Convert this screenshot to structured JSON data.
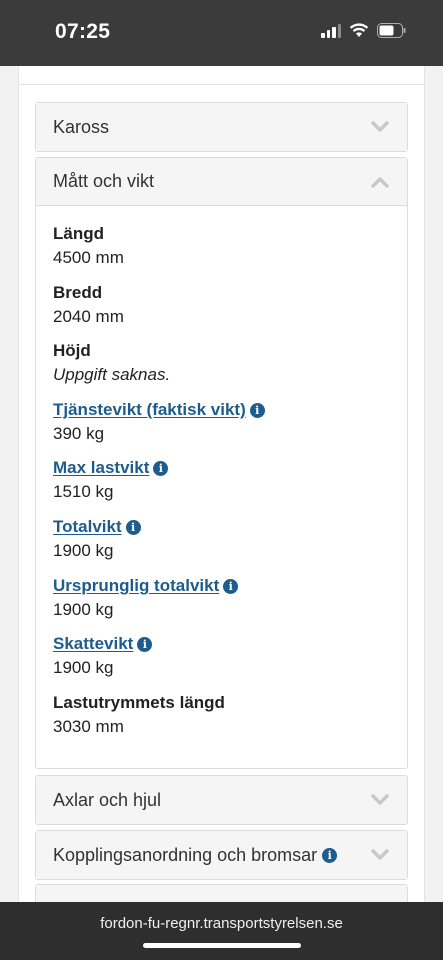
{
  "status_bar": {
    "time": "07:25"
  },
  "panels": {
    "kaross": {
      "title": "Kaross"
    },
    "matt": {
      "title": "Mått och vikt",
      "fields": [
        {
          "label": "Längd",
          "value": "4500 mm"
        },
        {
          "label": "Bredd",
          "value": "2040 mm"
        },
        {
          "label": "Höjd",
          "value": "Uppgift saknas."
        },
        {
          "label": "Tjänstevikt (faktisk vikt)",
          "value": "390 kg"
        },
        {
          "label": "Max lastvikt",
          "value": "1510 kg"
        },
        {
          "label": "Totalvikt",
          "value": "1900 kg"
        },
        {
          "label": "Ursprunglig totalvikt",
          "value": "1900 kg"
        },
        {
          "label": "Skattevikt",
          "value": "1900 kg"
        },
        {
          "label": "Lastutrymmets längd",
          "value": "3030 mm"
        }
      ]
    },
    "axlar": {
      "title": "Axlar och hjul"
    },
    "koppling": {
      "title": "Kopplingsanordning och bromsar"
    }
  },
  "url_bar": {
    "domain": "fordon-fu-regnr.transportstyrelsen.se"
  },
  "colors": {
    "link": "#1d5c8c",
    "status_bar": "#3b3b3b",
    "header_bg": "#f5f5f5"
  }
}
